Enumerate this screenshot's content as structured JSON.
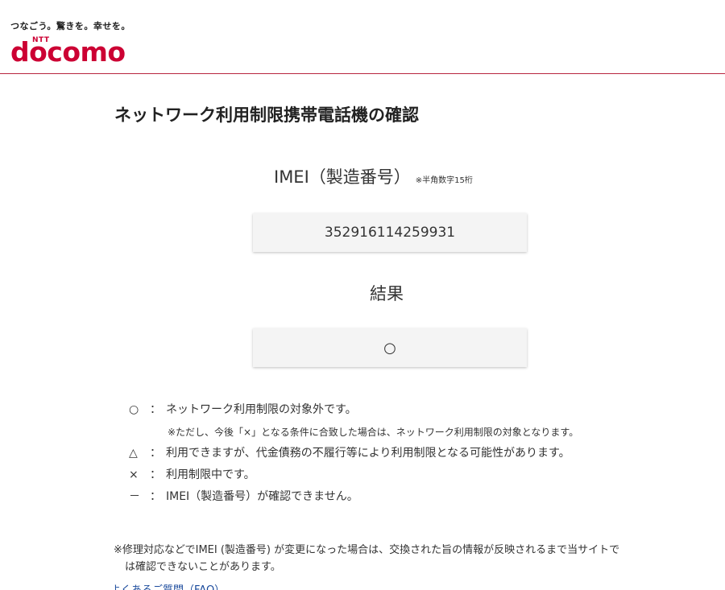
{
  "header": {
    "tagline": "つなごう。驚きを。幸せを。",
    "brand_small": "NTT",
    "brand": "docomo"
  },
  "title": "ネットワーク利用制限携帯電話機の確認",
  "imei": {
    "label": "IMEI（製造番号）",
    "note": "※半角数字15桁",
    "value": "352916114259931"
  },
  "result": {
    "label": "結果",
    "value": "○"
  },
  "legend": [
    {
      "symbol": "○",
      "colon": "：",
      "text": "ネットワーク利用制限の対象外です。"
    },
    {
      "symbol": "△",
      "colon": "：",
      "text": "利用できますが、代金債務の不履行等により利用制限となる可能性があります。"
    },
    {
      "symbol": "×",
      "colon": "：",
      "text": "利用制限中です。"
    },
    {
      "symbol": "－",
      "colon": "：",
      "text": "IMEI（製造番号）が確認できません。"
    }
  ],
  "legend_sub_note": "※ただし、今後「×」となる条件に合致した場合は、ネットワーク利用制限の対象となります。",
  "footnote": {
    "line1": "※修理対応などでIMEI (製造番号) が変更になった場合は、交換された旨の情報が反映されるまで当サイトで",
    "line2": "は確認できないことがあります。"
  },
  "faq_link": "よくあるご質問（FAQ）",
  "colors": {
    "brand": "#cc0033",
    "divider": "#b8243e",
    "field_bg": "#f4f4f4",
    "link": "#1a4a9c"
  }
}
